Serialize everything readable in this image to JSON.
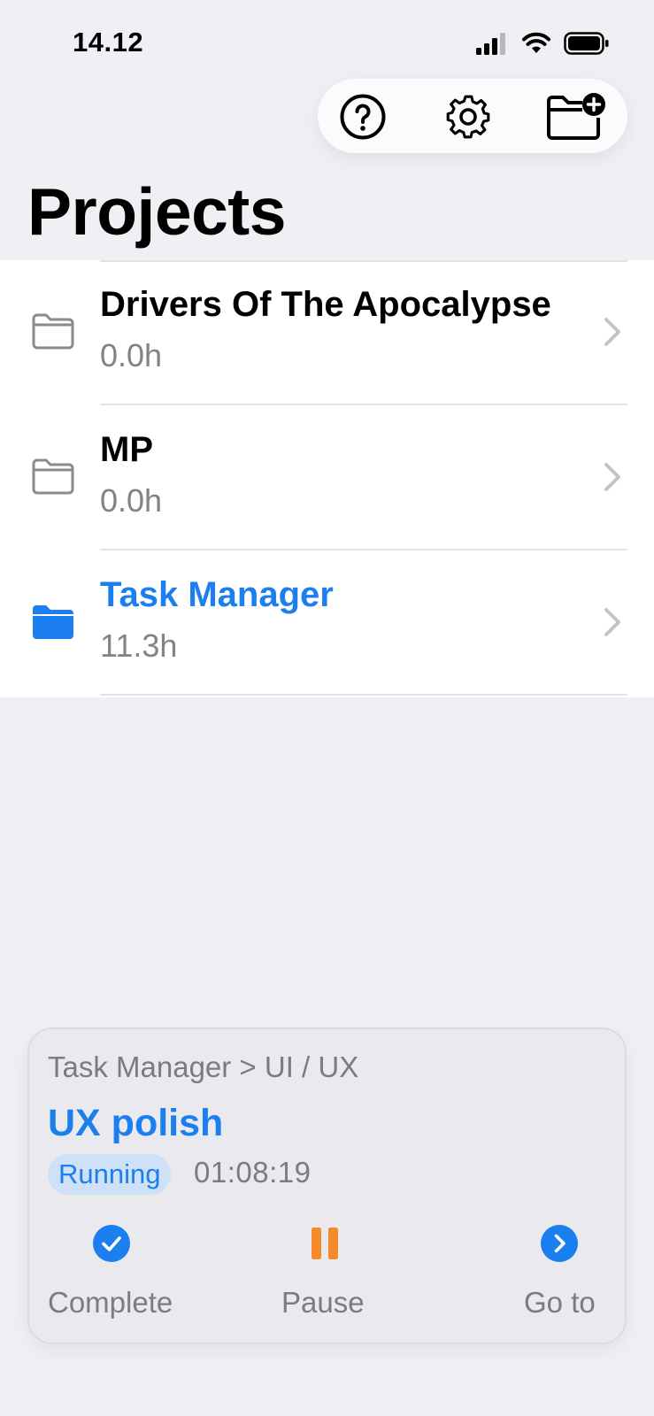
{
  "status_bar": {
    "time": "14.12"
  },
  "toolbar": {
    "icons": [
      "help-icon",
      "settings-gear-icon",
      "new-folder-plus-icon"
    ]
  },
  "page": {
    "title": "Projects"
  },
  "projects": [
    {
      "name": "Drivers Of The Apocalypse",
      "hours": "0.0h",
      "active": false
    },
    {
      "name": "MP",
      "hours": "0.0h",
      "active": false
    },
    {
      "name": "Task Manager",
      "hours": "11.3h",
      "active": true
    }
  ],
  "running_task": {
    "breadcrumb": "Task Manager > UI / UX",
    "title": "UX polish",
    "status": "Running",
    "elapsed": "01:08:19",
    "actions": {
      "complete": "Complete",
      "pause": "Pause",
      "goto": "Go to"
    }
  },
  "colors": {
    "accent": "#1b7ff0",
    "pause": "#f58a2a",
    "background": "#efeff4",
    "secondary_text": "#828287"
  }
}
